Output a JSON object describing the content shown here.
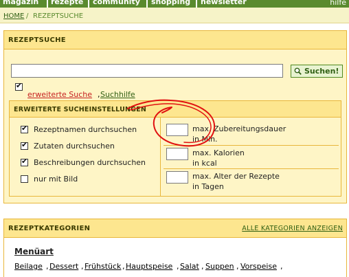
{
  "topnav": {
    "items": [
      "magazin",
      "rezepte",
      "community",
      "shopping",
      "newsletter"
    ],
    "right": "hilfe"
  },
  "breadcrumb": {
    "home": "HOME",
    "separator": "/",
    "current": "REZEPTSUCHE"
  },
  "search": {
    "title": "REZEPTSUCHE",
    "value": "",
    "placeholder": "",
    "button_label": "Suchen!",
    "extended_checked": true,
    "extended_link": "erweiterte Suche",
    "comma": ",",
    "help_link": "Suchhilfe"
  },
  "extended": {
    "title": "ERWEITERTE SUCHEINSTELLUNGEN",
    "options": [
      {
        "label": "Rezeptnamen durchsuchen",
        "checked": true
      },
      {
        "label": "Zutaten durchsuchen",
        "checked": true
      },
      {
        "label": "Beschreibungen durchsuchen",
        "checked": true
      },
      {
        "label": "nur mit Bild",
        "checked": false
      }
    ],
    "limits": [
      {
        "line1": "max. Zubereitungsdauer",
        "line2": "in Min.",
        "value": ""
      },
      {
        "line1": "max. Kalorien",
        "line2": "in kcal",
        "value": ""
      },
      {
        "line1": "max. Alter der Rezepte",
        "line2": "in Tagen",
        "value": ""
      }
    ]
  },
  "categories": {
    "title": "REZEPTKATEGORIEN",
    "all_link": "ALLE KATEGORIEN ANZEIGEN",
    "group_title": "Menüart",
    "items": [
      "Beilage",
      "Dessert",
      "Frühstück",
      "Hauptspeise",
      "Salat",
      "Suppen",
      "Vorspeise"
    ]
  },
  "colors": {
    "nav_green": "#5a8a2e",
    "panel_bg": "#fef5c6",
    "panel_head": "#fde68f",
    "panel_border": "#e8b63a",
    "link_red": "#c62020",
    "annotation_red": "#e01010"
  },
  "icons": {
    "search_button": "magnifier-icon",
    "checked": "checkmark-icon"
  }
}
